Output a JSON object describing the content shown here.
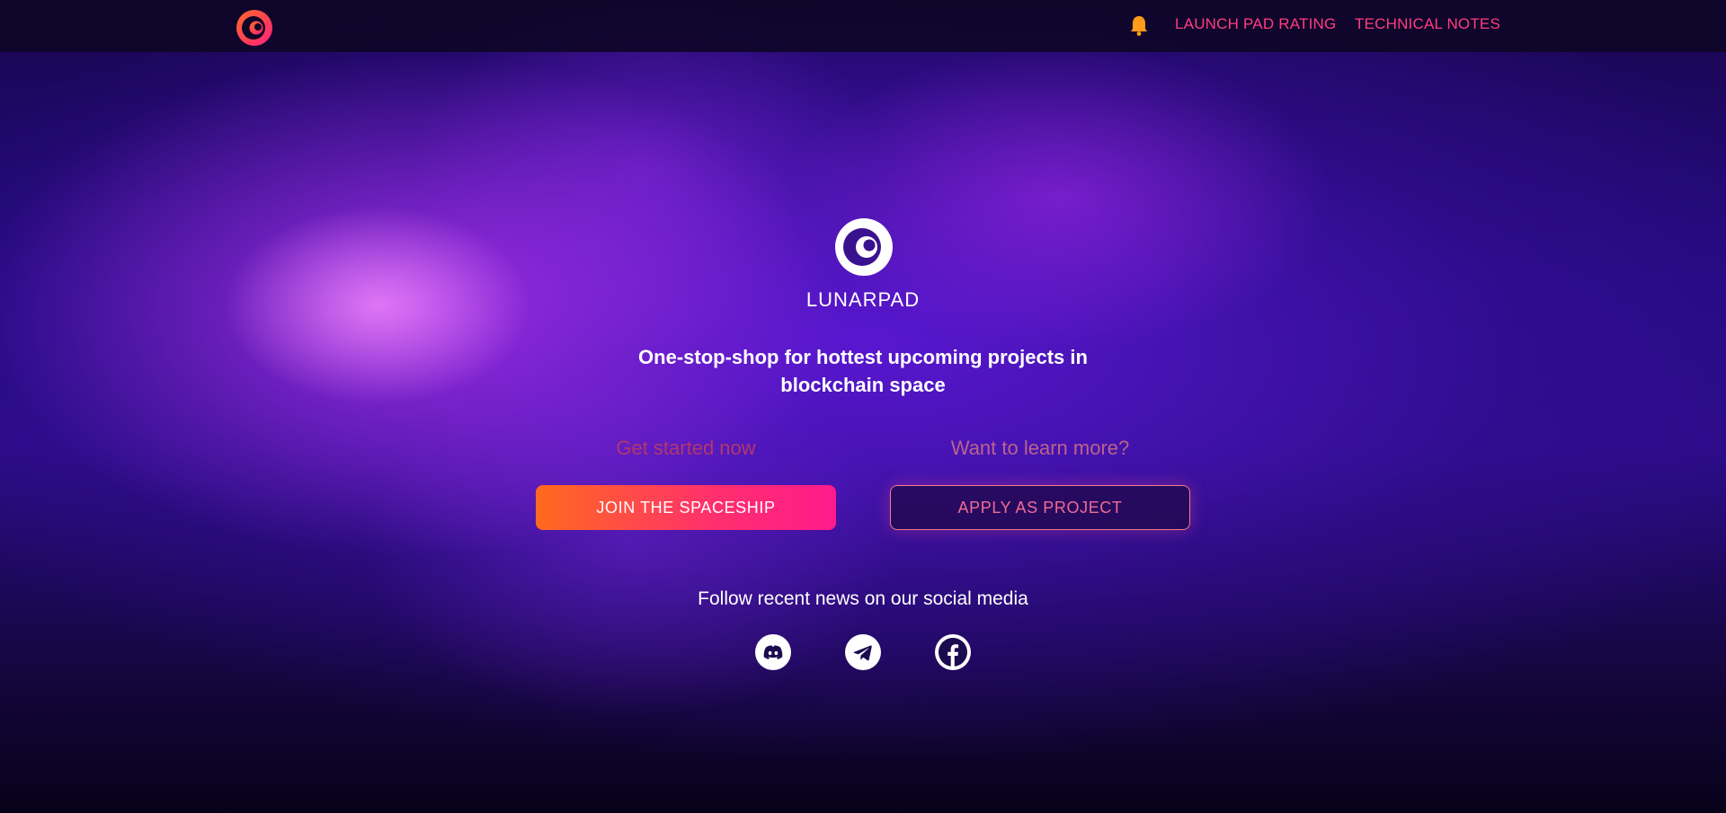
{
  "header": {
    "nav": {
      "launchpad_rating": "LAUNCH PAD RATING",
      "technical_notes": "TECHNICAL NOTES"
    },
    "icons": [
      "lunarpad-logo-icon",
      "bell-icon"
    ]
  },
  "hero": {
    "brand": "LUNARPAD",
    "tagline": "One-stop-shop for hottest upcoming projects in blockchain space",
    "left": {
      "label": "Get started now",
      "button": "JOIN THE SPACESHIP"
    },
    "right": {
      "label": "Want to learn more?",
      "button": "APPLY AS PROJECT"
    }
  },
  "social": {
    "heading": "Follow recent news on our social media",
    "icons": [
      "discord-icon",
      "telegram-icon",
      "facebook-icon"
    ]
  },
  "colors": {
    "accent": "#ff3d7f",
    "button_gradient_start": "#ff6a1e",
    "button_gradient_end": "#ff1a8c",
    "background": "#240a80"
  }
}
